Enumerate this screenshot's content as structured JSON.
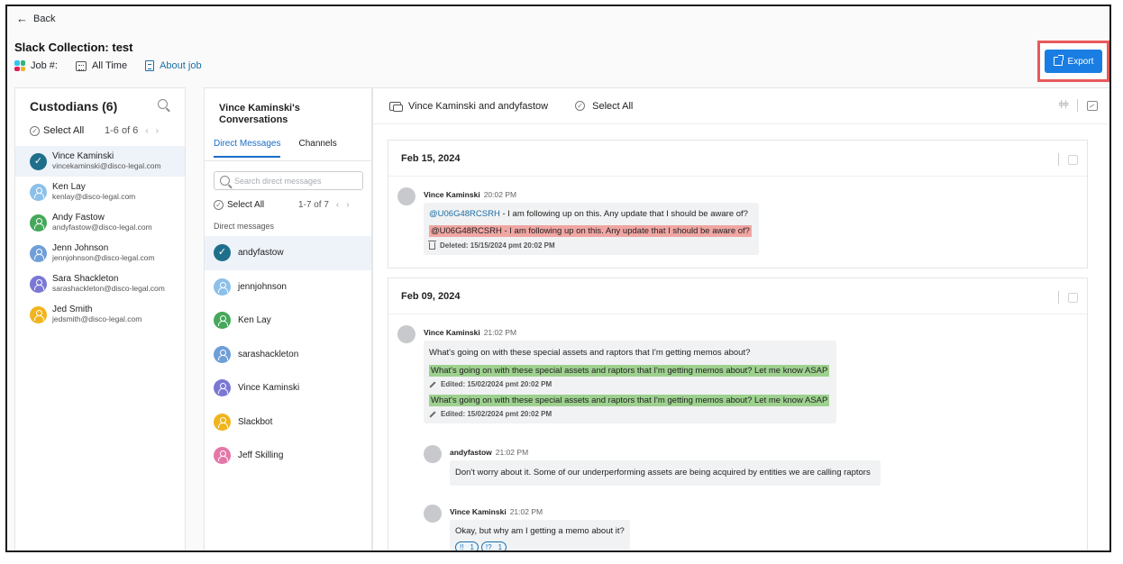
{
  "nav": {
    "back_label": "Back"
  },
  "header": {
    "title": "Slack Collection: test",
    "job_label": "Job #:",
    "time_range": "All Time",
    "about_link": "About job",
    "export_label": "Export"
  },
  "custodians": {
    "title": "Custodians (6)",
    "select_all": "Select All",
    "range": "1-6 of 6",
    "items": [
      {
        "name": "Vince Kaminski",
        "email": "vincekaminski@disco-legal.com",
        "color": "#1f6f8b",
        "selected": true
      },
      {
        "name": "Ken Lay",
        "email": "kenlay@disco-legal.com",
        "color": "#8cc0ea"
      },
      {
        "name": "Andy Fastow",
        "email": "andyfastow@disco-legal.com",
        "color": "#45a85a"
      },
      {
        "name": "Jenn Johnson",
        "email": "jennjohnson@disco-legal.com",
        "color": "#6f9fd8"
      },
      {
        "name": "Sara Shackleton",
        "email": "sarashackleton@disco-legal.com",
        "color": "#7a78d4"
      },
      {
        "name": "Jed Smith",
        "email": "jedsmith@disco-legal.com",
        "color": "#f0b51e"
      }
    ]
  },
  "conversations": {
    "title": "Vince Kaminski's Conversations",
    "tabs": [
      "Direct Messages",
      "Channels"
    ],
    "search_placeholder": "Search direct messages",
    "select_all": "Select All",
    "range": "1-7 of 7",
    "section_label": "Direct messages",
    "items": [
      {
        "name": "andyfastow",
        "color": "#1f6f8b",
        "selected": true
      },
      {
        "name": "jennjohnson",
        "color": "#8cc0ea"
      },
      {
        "name": "Ken Lay",
        "color": "#45a85a"
      },
      {
        "name": "sarashackleton",
        "color": "#6f9fd8"
      },
      {
        "name": "Vince Kaminski",
        "color": "#7a78d4"
      },
      {
        "name": "Slackbot",
        "color": "#f0b51e"
      },
      {
        "name": "Jeff Skilling",
        "color": "#e477a8"
      }
    ]
  },
  "main": {
    "conversation_title": "Vince Kaminski and andyfastow",
    "select_all": "Select All",
    "days": [
      {
        "date": "Feb 15, 2024",
        "messages": [
          {
            "author": "Vince Kaminski",
            "time": "20:02 PM",
            "mention": "@U06G48RCSRH",
            "text": " - I am following up on this. Any update that I should be aware of?",
            "deleted_mention": "@U06G48RCSRH",
            "deleted_text": " - I am following up on this. Any update that I should be aware of?",
            "deleted_note": "Deleted: 15/15/2024 pmt 20:02 PM"
          }
        ]
      },
      {
        "date": "Feb 09, 2024",
        "messages": [
          {
            "author": "Vince Kaminski",
            "time": "21:02 PM",
            "text": "What's going on with these special assets and raptors that I'm getting memos about?",
            "edits": [
              {
                "text": "What's going on with these special assets and raptors that I'm getting memos about? Let me know ASAP",
                "note": "Edited: 15/02/2024 pmt 20:02 PM"
              },
              {
                "text": "What's going on with these special assets and raptors that I'm getting memos about? Let me know ASAP",
                "note": "Edited: 15/02/2024 pmt 20:02 PM"
              }
            ]
          },
          {
            "author": "andyfastow",
            "time": "21:02 PM",
            "text": "Don't worry about it. Some of our underperforming assets are being acquired by entities we are calling raptors"
          },
          {
            "author": "Vince Kaminski",
            "time": "21:02 PM",
            "text": "Okay, but why am I getting a memo about it?",
            "reactions": [
              {
                "emoji": "!!",
                "count": "1"
              },
              {
                "emoji": "!?",
                "count": "1"
              }
            ]
          }
        ]
      }
    ]
  },
  "colors": {
    "accent": "#1a7de3",
    "highlight_box": "#e8595c",
    "deleted": "#f0a6a3",
    "edited": "#9ed18f"
  }
}
